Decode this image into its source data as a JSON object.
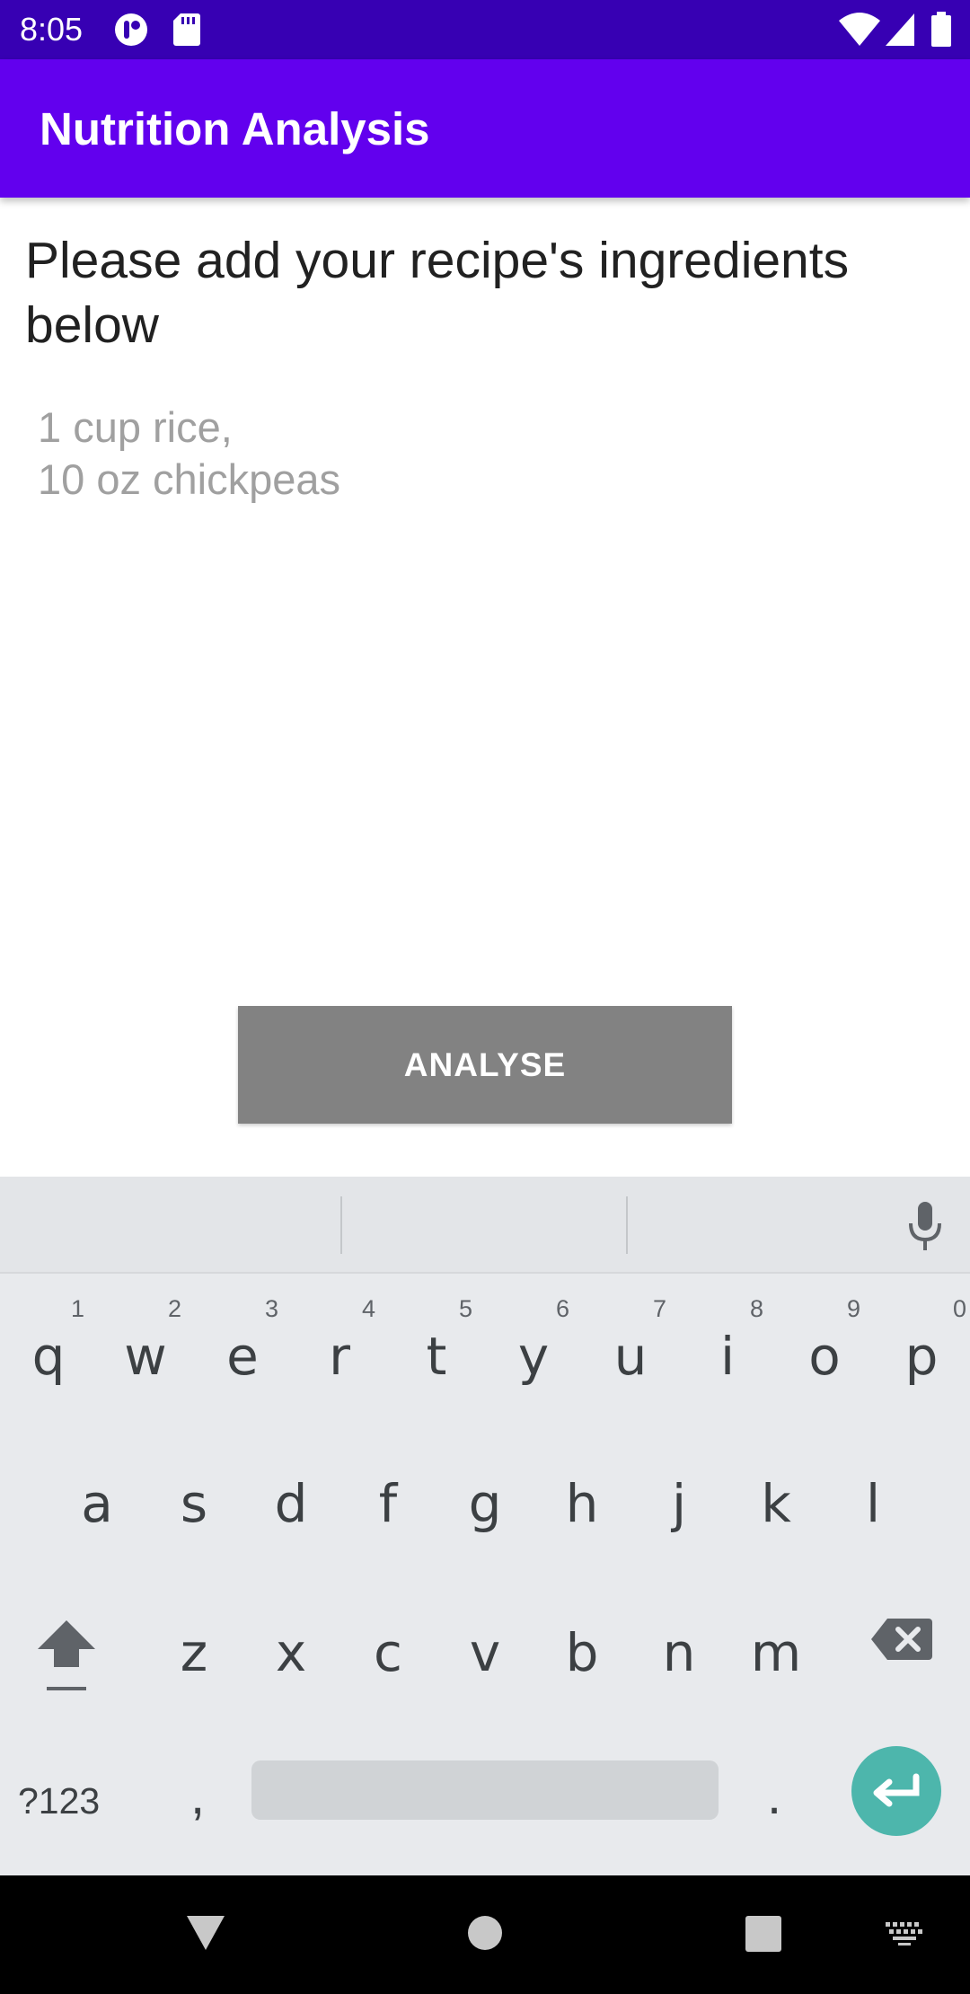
{
  "status_bar": {
    "time": "8:05"
  },
  "app_bar": {
    "title": "Nutrition Analysis"
  },
  "main": {
    "prompt": "Please add your recipe's ingredients below",
    "ingredients_input": {
      "value": "",
      "placeholder": "1 cup rice,\n10 oz chickpeas"
    },
    "analyse_button": "ANALYSE"
  },
  "keyboard": {
    "row1": [
      {
        "ch": "q",
        "num": "1"
      },
      {
        "ch": "w",
        "num": "2"
      },
      {
        "ch": "e",
        "num": "3"
      },
      {
        "ch": "r",
        "num": "4"
      },
      {
        "ch": "t",
        "num": "5"
      },
      {
        "ch": "y",
        "num": "6"
      },
      {
        "ch": "u",
        "num": "7"
      },
      {
        "ch": "i",
        "num": "8"
      },
      {
        "ch": "o",
        "num": "9"
      },
      {
        "ch": "p",
        "num": "0"
      }
    ],
    "row2": [
      "a",
      "s",
      "d",
      "f",
      "g",
      "h",
      "j",
      "k",
      "l"
    ],
    "row3": [
      "z",
      "x",
      "c",
      "v",
      "b",
      "n",
      "m"
    ],
    "symbols_label": "?123",
    "comma": ",",
    "period": "."
  },
  "icons": {
    "status": [
      "notification-app-icon",
      "sd-card-icon",
      "wifi-icon",
      "cell-signal-icon",
      "battery-icon"
    ],
    "keyboard": [
      "mic-icon",
      "shift-icon",
      "backspace-icon",
      "enter-icon"
    ],
    "nav": [
      "back-icon",
      "home-icon",
      "recents-icon",
      "keyboard-switch-icon"
    ]
  },
  "colors": {
    "status_bar": "#3700b3",
    "app_bar": "#6200ee",
    "button": "#828282",
    "enter_key": "#4db6ac",
    "keyboard_bg": "#e8eaed"
  }
}
